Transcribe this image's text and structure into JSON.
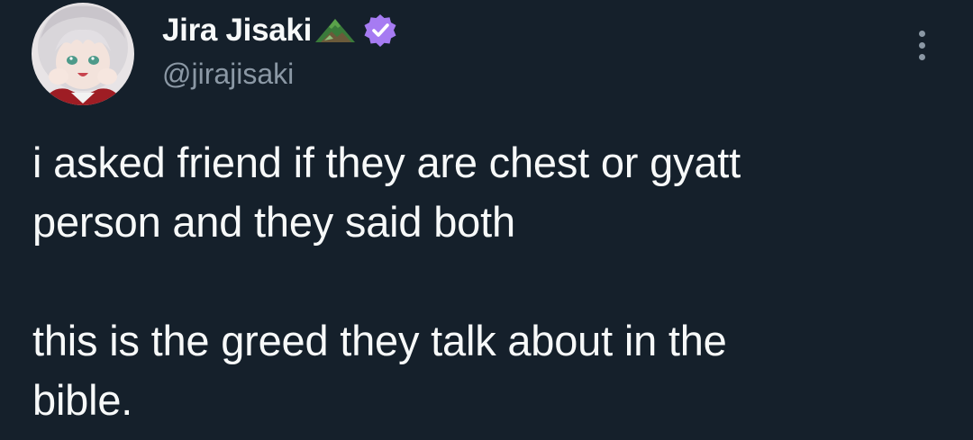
{
  "tweet": {
    "author": {
      "display_name": "Jira Jisaki",
      "handle": "@jirajisaki",
      "name_emoji": "mountain-icon",
      "verified_badge": "verified-badge-icon",
      "verified_color": "#a67bf2"
    },
    "more_menu": "more-options-icon",
    "text_paragraphs": [
      "i asked friend if they are chest or gyatt",
      "person and they said both",
      "",
      "this is the greed they talk about in the",
      "bible."
    ]
  },
  "colors": {
    "background": "#15202b",
    "primary_text": "#f7f9f9",
    "secondary_text": "#8b98a5"
  }
}
